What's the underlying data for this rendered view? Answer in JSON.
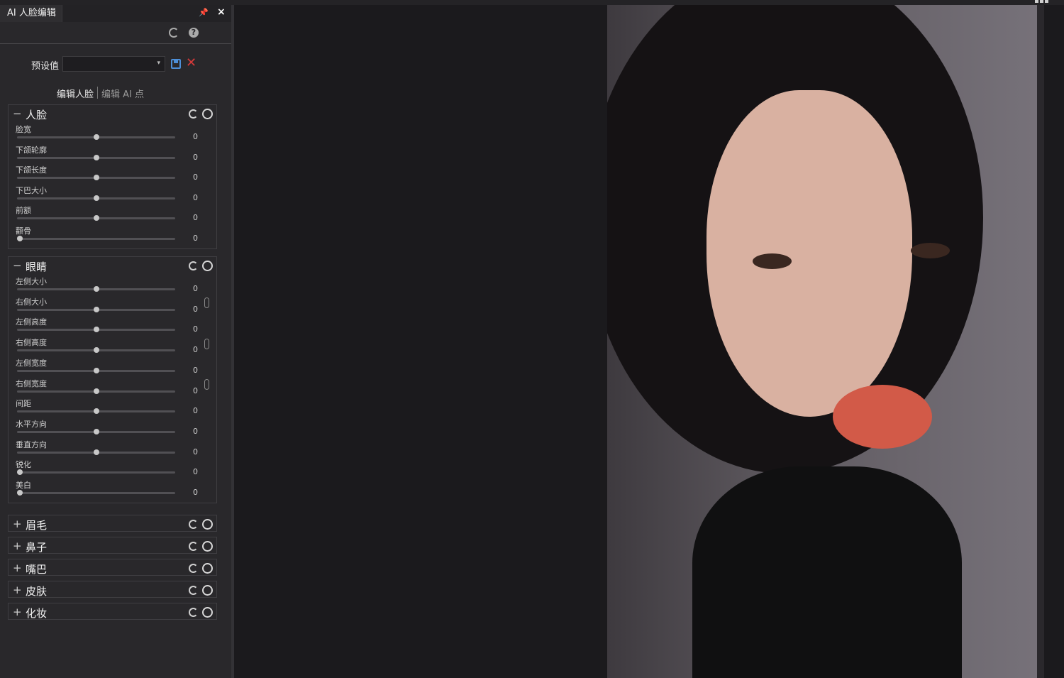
{
  "panel": {
    "tab_title": "AI 人脸编辑",
    "pin_glyph": "📌",
    "close_glyph": "×",
    "help_glyph": "?",
    "preset_label": "预设值",
    "preset_value": "",
    "subtabs": [
      "编辑人脸",
      "编辑 AI 点"
    ],
    "delete_glyph": "✕"
  },
  "sections": [
    {
      "title": "人脸",
      "expanded": true,
      "toggle": "−",
      "sliders": [
        {
          "label": "脸宽",
          "value": "0",
          "level": 0.5
        },
        {
          "label": "下颌轮廓",
          "value": "0",
          "level": 0.5
        },
        {
          "label": "下颌长度",
          "value": "0",
          "level": 0.5
        },
        {
          "label": "下巴大小",
          "value": "0",
          "level": 0.5
        },
        {
          "label": "前额",
          "value": "0",
          "level": 0.5
        },
        {
          "label": "颧骨",
          "value": "0",
          "level": 0.0
        }
      ]
    },
    {
      "title": "眼睛",
      "expanded": true,
      "toggle": "−",
      "sliders": [
        {
          "label": "左侧大小",
          "value": "0",
          "level": 0.5
        },
        {
          "label": "右侧大小",
          "value": "0",
          "level": 0.5
        },
        {
          "label": "左侧高度",
          "value": "0",
          "level": 0.5
        },
        {
          "label": "右侧高度",
          "value": "0",
          "level": 0.5
        },
        {
          "label": "左侧宽度",
          "value": "0",
          "level": 0.5
        },
        {
          "label": "右侧宽度",
          "value": "0",
          "level": 0.5
        },
        {
          "label": "间距",
          "value": "0",
          "level": 0.5
        },
        {
          "label": "水平方向",
          "value": "0",
          "level": 0.5
        },
        {
          "label": "垂直方向",
          "value": "0",
          "level": 0.5
        },
        {
          "label": "锐化",
          "value": "0",
          "level": 0.0
        },
        {
          "label": "美白",
          "value": "0",
          "level": 0.0
        }
      ]
    },
    {
      "title": "眉毛",
      "expanded": false,
      "toggle": "+"
    },
    {
      "title": "鼻子",
      "expanded": false,
      "toggle": "+"
    },
    {
      "title": "嘴巴",
      "expanded": false,
      "toggle": "+"
    },
    {
      "title": "皮肤",
      "expanded": false,
      "toggle": "+"
    },
    {
      "title": "化妆",
      "expanded": false,
      "toggle": "+"
    }
  ]
}
